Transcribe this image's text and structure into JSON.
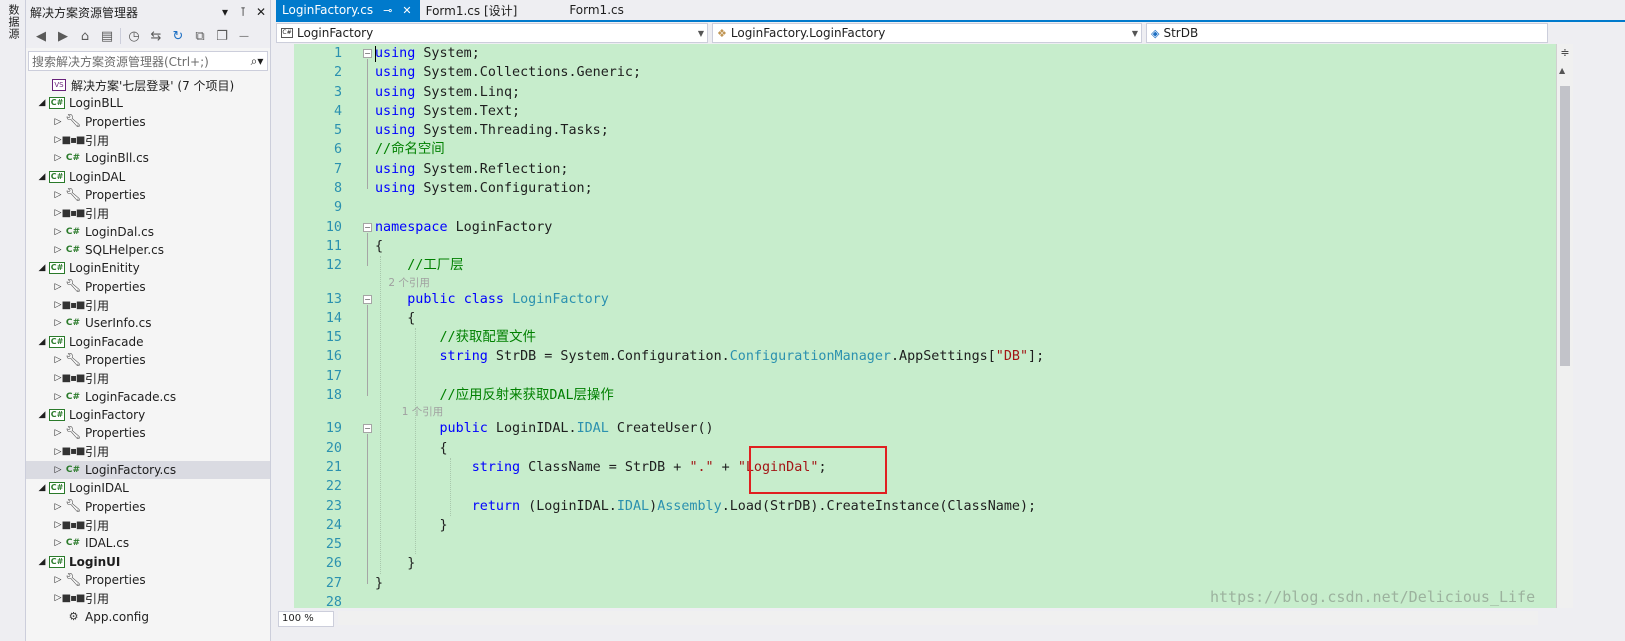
{
  "left_strip": {
    "label": "数据源"
  },
  "solution_explorer": {
    "title": "解决方案资源管理器",
    "search_placeholder": "搜索解决方案资源管理器(Ctrl+;)",
    "tree": [
      {
        "label": "解决方案'七层登录' (7 个项目)",
        "icon": "solution",
        "indent": 0,
        "arrow": ""
      },
      {
        "label": "LoginBLL",
        "icon": "csproj",
        "indent": 0,
        "arrow": "◢"
      },
      {
        "label": "Properties",
        "icon": "wrench",
        "indent": 1,
        "arrow": "▷"
      },
      {
        "label": "引用",
        "icon": "ref",
        "indent": 1,
        "arrow": "▷"
      },
      {
        "label": "LoginBll.cs",
        "icon": "csfile",
        "indent": 1,
        "arrow": "▷"
      },
      {
        "label": "LoginDAL",
        "icon": "csproj",
        "indent": 0,
        "arrow": "◢"
      },
      {
        "label": "Properties",
        "icon": "wrench",
        "indent": 1,
        "arrow": "▷"
      },
      {
        "label": "引用",
        "icon": "ref",
        "indent": 1,
        "arrow": "▷"
      },
      {
        "label": "LoginDal.cs",
        "icon": "csfile",
        "indent": 1,
        "arrow": "▷"
      },
      {
        "label": "SQLHelper.cs",
        "icon": "csfile",
        "indent": 1,
        "arrow": "▷"
      },
      {
        "label": "LoginEnitity",
        "icon": "csproj",
        "indent": 0,
        "arrow": "◢"
      },
      {
        "label": "Properties",
        "icon": "wrench",
        "indent": 1,
        "arrow": "▷"
      },
      {
        "label": "引用",
        "icon": "ref",
        "indent": 1,
        "arrow": "▷"
      },
      {
        "label": "UserInfo.cs",
        "icon": "csfile",
        "indent": 1,
        "arrow": "▷"
      },
      {
        "label": "LoginFacade",
        "icon": "csproj",
        "indent": 0,
        "arrow": "◢"
      },
      {
        "label": "Properties",
        "icon": "wrench",
        "indent": 1,
        "arrow": "▷"
      },
      {
        "label": "引用",
        "icon": "ref",
        "indent": 1,
        "arrow": "▷"
      },
      {
        "label": "LoginFacade.cs",
        "icon": "csfile",
        "indent": 1,
        "arrow": "▷"
      },
      {
        "label": "LoginFactory",
        "icon": "csproj",
        "indent": 0,
        "arrow": "◢"
      },
      {
        "label": "Properties",
        "icon": "wrench",
        "indent": 1,
        "arrow": "▷"
      },
      {
        "label": "引用",
        "icon": "ref",
        "indent": 1,
        "arrow": "▷"
      },
      {
        "label": "LoginFactory.cs",
        "icon": "csfile",
        "indent": 1,
        "arrow": "▷",
        "selected": true
      },
      {
        "label": "LoginIDAL",
        "icon": "csproj",
        "indent": 0,
        "arrow": "◢"
      },
      {
        "label": "Properties",
        "icon": "wrench",
        "indent": 1,
        "arrow": "▷"
      },
      {
        "label": "引用",
        "icon": "ref",
        "indent": 1,
        "arrow": "▷"
      },
      {
        "label": "IDAL.cs",
        "icon": "csfile",
        "indent": 1,
        "arrow": "▷"
      },
      {
        "label": "LoginUI",
        "icon": "csproj",
        "indent": 0,
        "arrow": "◢",
        "bold": true
      },
      {
        "label": "Properties",
        "icon": "wrench",
        "indent": 1,
        "arrow": "▷"
      },
      {
        "label": "引用",
        "icon": "ref",
        "indent": 1,
        "arrow": "▷"
      },
      {
        "label": "App.config",
        "icon": "config",
        "indent": 1,
        "arrow": ""
      }
    ]
  },
  "tabs": [
    {
      "label": "LoginFactory.cs",
      "active": true,
      "pin": "⊸",
      "close": "✕"
    },
    {
      "label": "Form1.cs [设计]",
      "active": false
    },
    {
      "label": "Form1.cs",
      "active": false
    }
  ],
  "navbar": {
    "project": "LoginFactory",
    "type": "LoginFactory.LoginFactory",
    "member": "StrDB"
  },
  "editor": {
    "lines": [
      {
        "n": "1",
        "tokens": [
          [
            "kw",
            "using"
          ],
          [
            "pl",
            " System;"
          ]
        ]
      },
      {
        "n": "2",
        "tokens": [
          [
            "kw",
            "using"
          ],
          [
            "pl",
            " System.Collections.Generic;"
          ]
        ]
      },
      {
        "n": "3",
        "tokens": [
          [
            "kw",
            "using"
          ],
          [
            "pl",
            " System.Linq;"
          ]
        ]
      },
      {
        "n": "4",
        "tokens": [
          [
            "kw",
            "using"
          ],
          [
            "pl",
            " System.Text;"
          ]
        ]
      },
      {
        "n": "5",
        "tokens": [
          [
            "kw",
            "using"
          ],
          [
            "pl",
            " System.Threading.Tasks;"
          ]
        ]
      },
      {
        "n": "6",
        "tokens": [
          [
            "cm",
            "//命名空间"
          ]
        ]
      },
      {
        "n": "7",
        "tokens": [
          [
            "kw",
            "using"
          ],
          [
            "pl",
            " System.Reflection;"
          ]
        ]
      },
      {
        "n": "8",
        "tokens": [
          [
            "kw",
            "using"
          ],
          [
            "pl",
            " System.Configuration;"
          ]
        ]
      },
      {
        "n": "9",
        "tokens": []
      },
      {
        "n": "10",
        "tokens": [
          [
            "kw",
            "namespace"
          ],
          [
            "pl",
            " LoginFactory"
          ]
        ]
      },
      {
        "n": "11",
        "tokens": [
          [
            "pl",
            "{"
          ]
        ]
      },
      {
        "n": "12",
        "tokens": [
          [
            "pl",
            "    "
          ],
          [
            "cm",
            "//工厂层"
          ]
        ]
      },
      {
        "n": "",
        "hint": "    2 个引用"
      },
      {
        "n": "13",
        "tokens": [
          [
            "pl",
            "    "
          ],
          [
            "kw",
            "public"
          ],
          [
            "pl",
            " "
          ],
          [
            "kw",
            "class"
          ],
          [
            "pl",
            " "
          ],
          [
            "ty",
            "LoginFactory"
          ]
        ]
      },
      {
        "n": "14",
        "tokens": [
          [
            "pl",
            "    {"
          ]
        ]
      },
      {
        "n": "15",
        "tokens": [
          [
            "pl",
            "        "
          ],
          [
            "cm",
            "//获取配置文件"
          ]
        ]
      },
      {
        "n": "16",
        "tokens": [
          [
            "pl",
            "        "
          ],
          [
            "kw",
            "string"
          ],
          [
            "pl",
            " StrDB = System.Configuration."
          ],
          [
            "ty",
            "ConfigurationManager"
          ],
          [
            "pl",
            ".AppSettings["
          ],
          [
            "str",
            "\"DB\""
          ],
          [
            "pl",
            "];"
          ]
        ]
      },
      {
        "n": "17",
        "tokens": []
      },
      {
        "n": "18",
        "tokens": [
          [
            "pl",
            "        "
          ],
          [
            "cm",
            "//应用反射来获取DAL层操作"
          ]
        ]
      },
      {
        "n": "",
        "hint": "        1 个引用"
      },
      {
        "n": "19",
        "tokens": [
          [
            "pl",
            "        "
          ],
          [
            "kw",
            "public"
          ],
          [
            "pl",
            " LoginIDAL."
          ],
          [
            "ty",
            "IDAL"
          ],
          [
            "pl",
            " CreateUser()"
          ]
        ]
      },
      {
        "n": "20",
        "tokens": [
          [
            "pl",
            "        {"
          ]
        ]
      },
      {
        "n": "21",
        "tokens": [
          [
            "pl",
            "            "
          ],
          [
            "kw",
            "string"
          ],
          [
            "pl",
            " ClassName = StrDB + "
          ],
          [
            "str",
            "\".\""
          ],
          [
            "pl",
            " + "
          ],
          [
            "str",
            "\"LoginDal\""
          ],
          [
            "pl",
            ";"
          ]
        ]
      },
      {
        "n": "22",
        "tokens": []
      },
      {
        "n": "23",
        "tokens": [
          [
            "pl",
            "            "
          ],
          [
            "kw",
            "return"
          ],
          [
            "pl",
            " (LoginIDAL."
          ],
          [
            "ty",
            "IDAL"
          ],
          [
            "pl",
            ")"
          ],
          [
            "ty",
            "Assembly"
          ],
          [
            "pl",
            ".Load(StrDB).CreateInstance(ClassName);"
          ]
        ]
      },
      {
        "n": "24",
        "tokens": [
          [
            "pl",
            "        }"
          ]
        ]
      },
      {
        "n": "25",
        "tokens": []
      },
      {
        "n": "26",
        "tokens": [
          [
            "pl",
            "    }"
          ]
        ]
      },
      {
        "n": "27",
        "tokens": [
          [
            "pl",
            "}"
          ]
        ]
      },
      {
        "n": "28",
        "tokens": []
      }
    ]
  },
  "zoom": "100 %",
  "watermark": "https://blog.csdn.net/Delicious_Life",
  "colors": {
    "accent": "#007acc",
    "editor_bg": "#c7edcc",
    "highlight_box": "#e02020"
  }
}
